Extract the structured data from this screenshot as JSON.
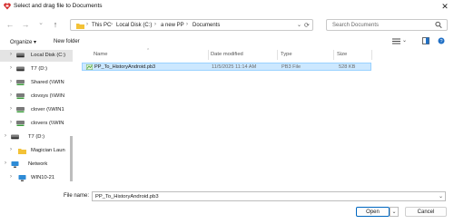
{
  "window": {
    "title": "Select and drag file to Documents",
    "close": "✕"
  },
  "nav": {
    "back": "←",
    "forward": "→",
    "dropdown": "⌄",
    "up": "↑",
    "refresh": "⟳"
  },
  "address": {
    "segments": [
      "This PC",
      "Local Disk (C:)",
      "a new PP",
      "Documents"
    ],
    "separator": "›"
  },
  "search": {
    "placeholder": "Search Documents"
  },
  "toolbar": {
    "organize": "Organize ▾",
    "new_folder": "New folder"
  },
  "sidebar": {
    "items": [
      {
        "label": "Local Disk (C:)",
        "icon": "drive-icon",
        "selected": true
      },
      {
        "label": "T7 (D:)",
        "icon": "drive-icon"
      },
      {
        "label": "Shared (\\\\WIN",
        "icon": "network-drive-icon"
      },
      {
        "label": "clovsys (\\\\WIN",
        "icon": "network-drive-icon"
      },
      {
        "label": "clover (\\\\WIN1",
        "icon": "network-drive-icon"
      },
      {
        "label": "clovers (\\\\WIN",
        "icon": "network-drive-icon"
      },
      {
        "label": "T7 (D:)",
        "icon": "drive-icon"
      },
      {
        "label": "Magician Laun",
        "icon": "folder-icon"
      },
      {
        "label": "Network",
        "icon": "network-icon"
      },
      {
        "label": "WIN10-21",
        "icon": "computer-icon"
      }
    ]
  },
  "columns": {
    "name": "Name",
    "date": "Date modified",
    "type": "Type",
    "size": "Size"
  },
  "files": [
    {
      "name": "PP_To_HistoryAndroid.pb3",
      "date": "11/5/2025 11:14 AM",
      "type": "PB3 File",
      "size": "528 KB"
    }
  ],
  "bottom": {
    "file_name_label": "File name:",
    "file_name_value": "PP_To_HistoryAndroid.pb3",
    "open": "Open",
    "cancel": "Cancel"
  },
  "colors": {
    "selection": "#cce8ff",
    "accent": "#0067c0",
    "folder": "#f3c237"
  }
}
